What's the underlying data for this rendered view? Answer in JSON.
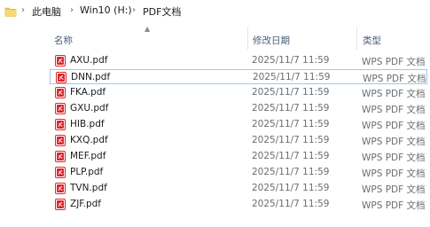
{
  "breadcrumb": {
    "items": [
      {
        "label": "此电脑"
      },
      {
        "label": "Win10 (H:)"
      },
      {
        "label": "PDF文档"
      }
    ]
  },
  "columns": {
    "name": "名称",
    "date": "修改日期",
    "type": "类型"
  },
  "files": [
    {
      "name": "AXU.pdf",
      "date": "2025/11/7 11:59",
      "type": "WPS PDF 文档"
    },
    {
      "name": "DNN.pdf",
      "date": "2025/11/7 11:59",
      "type": "WPS PDF 文档"
    },
    {
      "name": "FKA.pdf",
      "date": "2025/11/7 11:59",
      "type": "WPS PDF 文档"
    },
    {
      "name": "GXU.pdf",
      "date": "2025/11/7 11:59",
      "type": "WPS PDF 文档"
    },
    {
      "name": "HIB.pdf",
      "date": "2025/11/7 11:59",
      "type": "WPS PDF 文档"
    },
    {
      "name": "KXQ.pdf",
      "date": "2025/11/7 11:59",
      "type": "WPS PDF 文档"
    },
    {
      "name": "MEF.pdf",
      "date": "2025/11/7 11:59",
      "type": "WPS PDF 文档"
    },
    {
      "name": "PLP.pdf",
      "date": "2025/11/7 11:59",
      "type": "WPS PDF 文档"
    },
    {
      "name": "TVN.pdf",
      "date": "2025/11/7 11:59",
      "type": "WPS PDF 文档"
    },
    {
      "name": "ZJF.pdf",
      "date": "2025/11/7 11:59",
      "type": "WPS PDF 文档"
    }
  ],
  "focused_row": "DNN.pdf",
  "colors": {
    "header_text": "#4c607a",
    "focus_border": "#99c9ef",
    "pdf_icon": "#d9262b",
    "folder_icon": "#f2c14b"
  }
}
